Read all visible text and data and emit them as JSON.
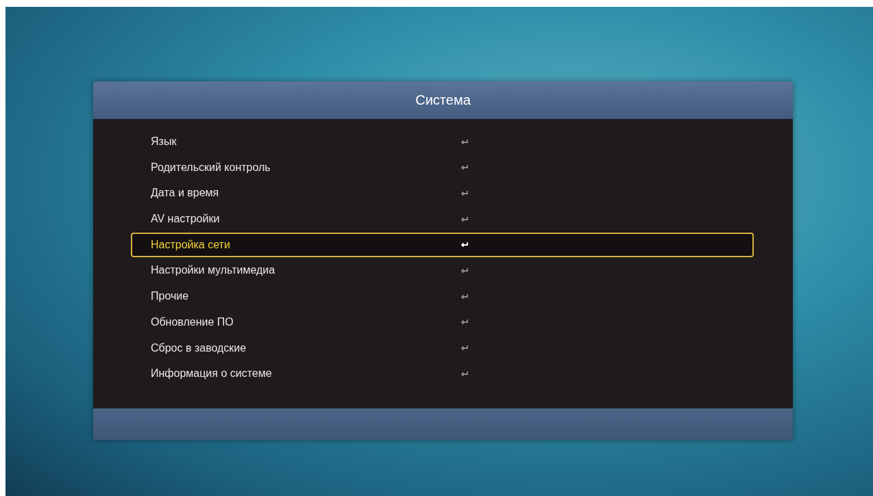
{
  "menu": {
    "title": "Система",
    "items": [
      {
        "label": "Язык",
        "selected": false
      },
      {
        "label": "Родительский контроль",
        "selected": false
      },
      {
        "label": "Дата и время",
        "selected": false
      },
      {
        "label": "AV настройки",
        "selected": false
      },
      {
        "label": "Настройка сети",
        "selected": true
      },
      {
        "label": "Настройки мультимедиа",
        "selected": false
      },
      {
        "label": "Прочие",
        "selected": false
      },
      {
        "label": "Обновление ПО",
        "selected": false
      },
      {
        "label": "Сброс в заводские",
        "selected": false
      },
      {
        "label": "Информация о системе",
        "selected": false
      }
    ]
  }
}
